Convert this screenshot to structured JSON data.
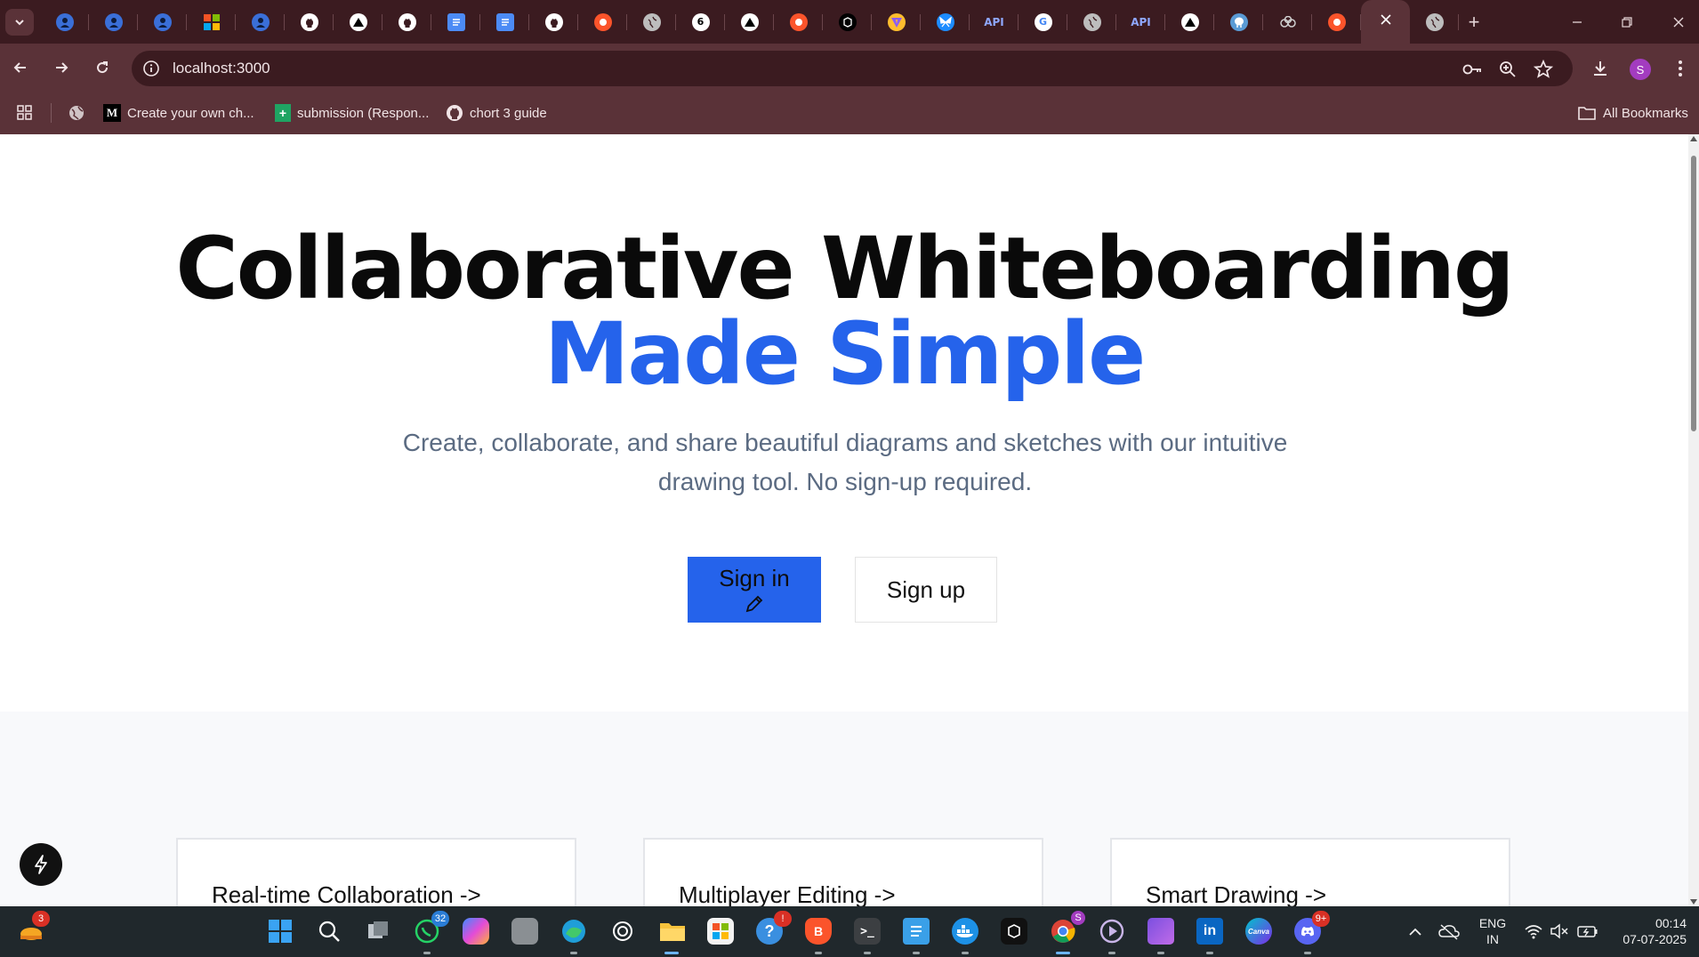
{
  "browser": {
    "tabs": [
      {
        "icon": "cartoon-avatar-icon",
        "color": "#3a6fd8"
      },
      {
        "icon": "cartoon-avatar-icon",
        "color": "#3a6fd8"
      },
      {
        "icon": "cartoon-avatar-icon",
        "color": "#3a6fd8"
      },
      {
        "icon": "microsoft-icon",
        "color": "#f35325"
      },
      {
        "icon": "cartoon-avatar-icon",
        "color": "#3a6fd8"
      },
      {
        "icon": "github-icon",
        "color": "#ffffff"
      },
      {
        "icon": "triangle-logo-icon",
        "color": "#000000"
      },
      {
        "icon": "github-icon",
        "color": "#ffffff"
      },
      {
        "icon": "google-docs-icon",
        "color": "#4c8bf5"
      },
      {
        "icon": "google-docs-icon",
        "color": "#4c8bf5"
      },
      {
        "icon": "github-icon",
        "color": "#ffffff"
      },
      {
        "icon": "brave-search-icon",
        "color": "#fb542b"
      },
      {
        "icon": "globe-icon",
        "color": "#bdbdbd"
      },
      {
        "icon": "six-logo-icon",
        "color": "#ffffff"
      },
      {
        "icon": "triangle-logo-icon",
        "color": "#000000"
      },
      {
        "icon": "brave-search-icon",
        "color": "#fb542b"
      },
      {
        "icon": "box-logo-icon",
        "color": "#000000"
      },
      {
        "icon": "vite-icon",
        "color": "#ffbd2e"
      },
      {
        "icon": "butterfly-icon",
        "color": "#1d8cff"
      },
      {
        "icon": "api-text-icon",
        "color": "#8fa8ff",
        "text": "API"
      },
      {
        "icon": "google-logo-icon",
        "color": "#ffffff"
      },
      {
        "icon": "globe-icon",
        "color": "#bdbdbd"
      },
      {
        "icon": "api-text-icon",
        "color": "#8fa8ff",
        "text": "API"
      },
      {
        "icon": "triangle-logo-icon",
        "color": "#000000"
      },
      {
        "icon": "postgres-elephant-icon",
        "color": "#5a9bd5"
      },
      {
        "icon": "rings-logo-icon",
        "color": "#c0c0c0"
      },
      {
        "icon": "brave-search-icon",
        "color": "#fb542b"
      },
      {
        "icon": "close-icon",
        "color": "#ffffff",
        "active": true
      },
      {
        "icon": "globe-icon",
        "color": "#bdbdbd"
      }
    ],
    "url": "localhost:3000",
    "profile_initial": "S",
    "bookmarks": [
      {
        "label": "Create your own ch...",
        "icon": "medium-icon"
      },
      {
        "label": "submission (Respon...",
        "icon": "google-sheets-icon"
      },
      {
        "label": "chort 3 guide",
        "icon": "github-icon"
      }
    ],
    "all_bookmarks_label": "All Bookmarks"
  },
  "hero": {
    "title_line1": "Collaborative Whiteboarding",
    "title_line2": "Made Simple",
    "subtitle": "Create, collaborate, and share beautiful diagrams and sketches with our intuitive drawing tool. No sign-up required.",
    "signin_label": "Sign in",
    "signup_label": "Sign up",
    "accent_color": "#2563eb"
  },
  "features": [
    {
      "title": "Real-time Collaboration ->"
    },
    {
      "title": "Multiplayer Editing ->"
    },
    {
      "title": "Smart Drawing ->"
    }
  ],
  "taskbar": {
    "weather_badge": "3",
    "whatsapp_badge": "32",
    "brave_badge": "!",
    "chrome_badge": "S",
    "discord_badge": "9+",
    "canva_label": "Canva",
    "language": "ENG",
    "region": "IN",
    "time": "00:14",
    "date": "07-07-2025"
  }
}
